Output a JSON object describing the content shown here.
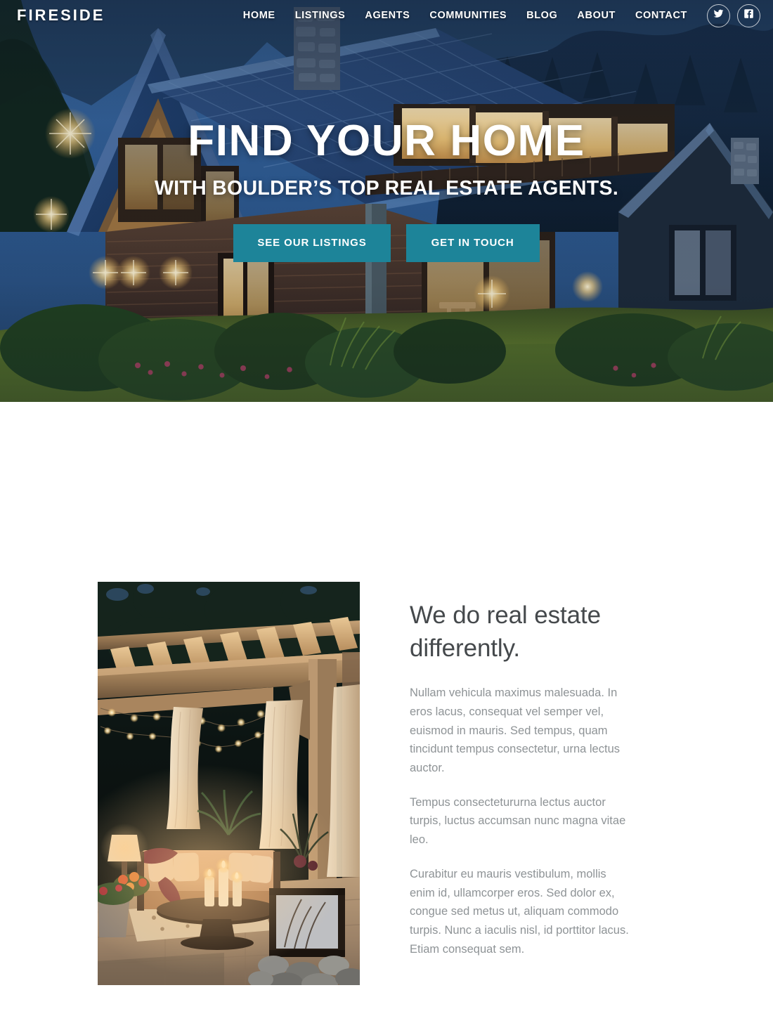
{
  "header": {
    "brand": "FIRESIDE",
    "nav": [
      {
        "label": "HOME",
        "name": "nav-home"
      },
      {
        "label": "LISTINGS",
        "name": "nav-listings"
      },
      {
        "label": "AGENTS",
        "name": "nav-agents"
      },
      {
        "label": "COMMUNITIES",
        "name": "nav-communities"
      },
      {
        "label": "BLOG",
        "name": "nav-blog"
      },
      {
        "label": "ABOUT",
        "name": "nav-about"
      },
      {
        "label": "CONTACT",
        "name": "nav-contact"
      }
    ],
    "social": [
      {
        "icon": "twitter-icon",
        "label": "Twitter"
      },
      {
        "icon": "facebook-icon",
        "label": "Facebook"
      }
    ]
  },
  "hero": {
    "title": "FIND YOUR HOME",
    "subtitle": "WITH BOULDER’S TOP REAL ESTATE AGENTS.",
    "primary_cta": "SEE OUR LISTINGS",
    "secondary_cta": "GET IN TOUCH",
    "image_alt": "Modern twilight home with blue tile roof, warm lit windows and landscaped garden"
  },
  "about": {
    "heading": "We do real estate differently.",
    "paragraphs": [
      "Nullam vehicula maximus malesuada. In eros lacus, consequat vel semper vel, euismod in mauris. Sed tempus, quam tincidunt tempus consectetur, urna lectus auctor.",
      "Tempus consectetururna lectus auctor turpis, luctus accumsan nunc magna vitae leo.",
      "Curabitur eu mauris vestibulum, mollis enim id, ullamcorper eros. Sed dolor ex, congue sed metus ut, aliquam commodo turpis. Nunc a iaculis nisl, id porttitor lacus. Etiam consequat sem."
    ],
    "image_alt": "Evening patio under a wooden pergola with string lights, white curtains, sofa and candles"
  },
  "colors": {
    "accent_teal": "#1d8499",
    "heading_gray": "#45494c",
    "body_gray": "#8e9396",
    "white": "#ffffff",
    "hero_sky": "#2f5d96"
  }
}
